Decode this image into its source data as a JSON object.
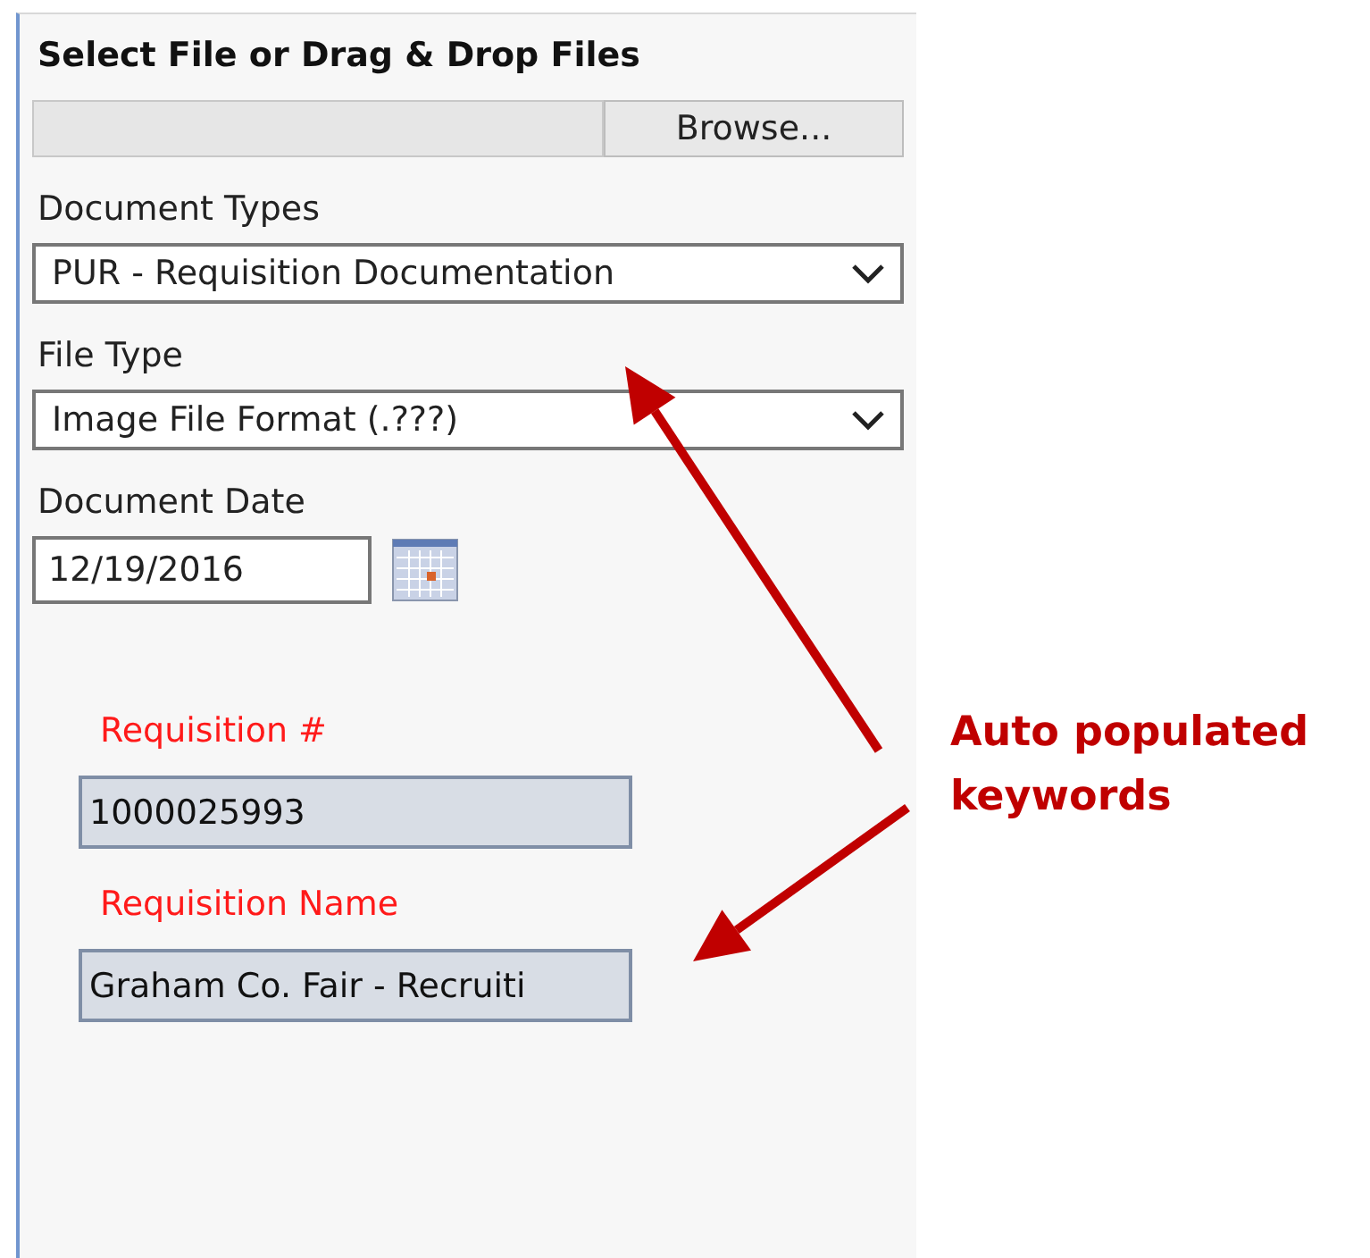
{
  "heading": "Select File or Drag & Drop Files",
  "file_picker": {
    "button": "Browse..."
  },
  "fields": [
    {
      "kind": "select",
      "label": "Document Types",
      "value": "PUR - Requisition Documentation"
    },
    {
      "kind": "select",
      "label": "File Type",
      "value": "Image File Format (.???)"
    },
    {
      "kind": "date",
      "label": "Document Date",
      "value": "12/19/2016"
    }
  ],
  "keywords": [
    {
      "label": "Requisition #",
      "value": "1000025993"
    },
    {
      "label": "Requisition Name",
      "value": "Graham Co. Fair - Recruiti"
    }
  ],
  "annotation": {
    "text": "Auto populated keywords"
  }
}
